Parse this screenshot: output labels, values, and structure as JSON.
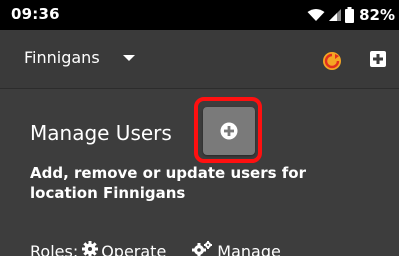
{
  "status_bar": {
    "time": "09:36",
    "battery": "82%",
    "icons": [
      "wifi-icon",
      "signal-icon",
      "battery-icon"
    ]
  },
  "toolbar": {
    "location": "Finnigans",
    "icons": [
      "caret-down-icon",
      "refresh-icon",
      "add-square-icon"
    ]
  },
  "main": {
    "title": "Manage Users",
    "add_button_icon": "plus-circle-icon",
    "description": "Add, remove or update users for location Finnigans",
    "roles_label": "Roles:",
    "roles": [
      {
        "label": "Operate",
        "icon": "gear-icon"
      },
      {
        "label": "Manage",
        "icon": "gears-icon"
      }
    ]
  },
  "colors": {
    "background": "#3d3d3d",
    "status_bar": "#000000",
    "highlight": "#ff1010",
    "button": "#7a7a7a",
    "refresh_accent": "#f5a623"
  }
}
